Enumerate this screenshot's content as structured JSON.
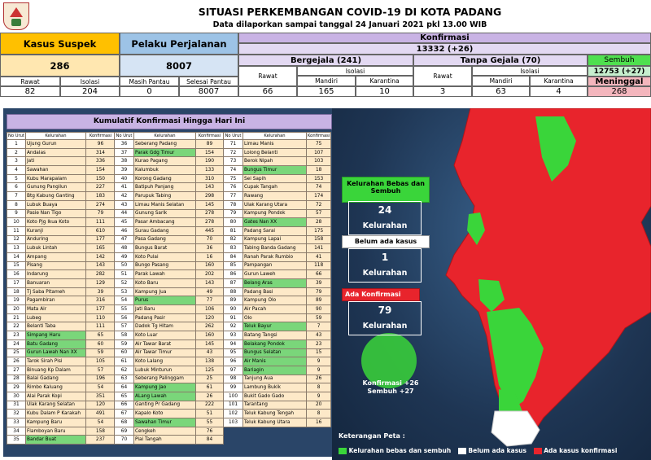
{
  "header": {
    "title": "SITUASI PERKEMBANGAN COVID-19 DI KOTA PADANG",
    "subtitle": "Data dilaporkan sampai tanggal 24 Januari 2021 pkl 13.00 WIB"
  },
  "stats": {
    "suspek_label": "Kasus Suspek",
    "suspek_value": "286",
    "rawat_label": "Rawat",
    "rawat_value": "82",
    "isolasi_label": "Isolasi",
    "isolasi_value": "204",
    "pelaku_label": "Pelaku Perjalanan",
    "pelaku_value": "8007",
    "masih_label": "Masih Pantau",
    "masih_value": "0",
    "selesai_label": "Selesai Pantau",
    "selesai_value": "8007",
    "konfirmasi_label": "Konfirmasi",
    "konfirmasi_value": "13332 (+26)",
    "bergejala_label": "Bergejala (241)",
    "tanpa_label": "Tanpa Gejala (70)",
    "sembuh_label": "Sembuh",
    "sembuh_value": "12753 (+27)",
    "meninggal_label": "Meninggal",
    "meninggal_value": "268",
    "bg_rawat_label": "Rawat",
    "bg_rawat_value": "66",
    "bg_isolasi_label": "Isolasi",
    "bg_mandiri_label": "Mandiri",
    "bg_mandiri_value": "165",
    "bg_karantina_label": "Karantina",
    "bg_karantina_value": "10",
    "tg_rawat_label": "Rawat",
    "tg_rawat_value": "3",
    "tg_isolasi_label": "Isolasi",
    "tg_mandiri_label": "Mandiri",
    "tg_mandiri_value": "63",
    "tg_karantina_label": "Karantina",
    "tg_karantina_value": "4"
  },
  "table": {
    "title": "Kumulatif Konfirmasi Hingga Hari Ini",
    "col_no": "No Urut",
    "col_kel": "Kelurahan",
    "col_konf": "Konfirmasi",
    "rows": [
      [
        "1",
        "Ujung Gurun",
        "96",
        ""
      ],
      [
        "2",
        "Andalas",
        "314",
        ""
      ],
      [
        "3",
        "Jati",
        "336",
        ""
      ],
      [
        "4",
        "Sawahan",
        "154",
        ""
      ],
      [
        "5",
        "Kubu Marapalam",
        "150",
        ""
      ],
      [
        "6",
        "Gunung Pangilun",
        "227",
        ""
      ],
      [
        "7",
        "Btg Kabung Ganting",
        "183",
        ""
      ],
      [
        "8",
        "Lubuk Buaya",
        "274",
        ""
      ],
      [
        "9",
        "Pasie Nan Tigo",
        "79",
        ""
      ],
      [
        "10",
        "Koto Pjg Ikua Koto",
        "111",
        ""
      ],
      [
        "11",
        "Kuranji",
        "610",
        ""
      ],
      [
        "12",
        "Anduring",
        "177",
        ""
      ],
      [
        "13",
        "Lubuk Lintah",
        "165",
        ""
      ],
      [
        "14",
        "Ampang",
        "142",
        ""
      ],
      [
        "15",
        "Pisang",
        "143",
        ""
      ],
      [
        "16",
        "Indarung",
        "282",
        ""
      ],
      [
        "17",
        "Banuaran",
        "129",
        ""
      ],
      [
        "18",
        "Tj Saba Pitameh",
        "39",
        ""
      ],
      [
        "19",
        "Pagambiran",
        "316",
        ""
      ],
      [
        "20",
        "Mata Air",
        "177",
        ""
      ],
      [
        "21",
        "Lubeg",
        "110",
        ""
      ],
      [
        "22",
        "Belanti Taba",
        "111",
        ""
      ],
      [
        "23",
        "Simpang Haru",
        "65",
        "g"
      ],
      [
        "24",
        "Batu Gadang",
        "60",
        "g"
      ],
      [
        "25",
        "Gurun Lawah Nan XX",
        "59",
        "g"
      ],
      [
        "26",
        "Tarok Sirah Pisi",
        "105",
        ""
      ],
      [
        "27",
        "Binuang Kp Dalam",
        "57",
        ""
      ],
      [
        "28",
        "Balai Gadang",
        "196",
        ""
      ],
      [
        "29",
        "Rimbo Kaluang",
        "54",
        ""
      ],
      [
        "30",
        "Alai Parak Kopi",
        "351",
        ""
      ],
      [
        "31",
        "Ulak Karang Selatan",
        "120",
        ""
      ],
      [
        "32",
        "Kubu Dalam P Karakah",
        "491",
        ""
      ],
      [
        "33",
        "Kampung Baru",
        "54",
        ""
      ],
      [
        "34",
        "Flamboyan Baru",
        "158",
        ""
      ],
      [
        "35",
        "Bandar Buat",
        "237",
        "g"
      ]
    ],
    "rows2": [
      [
        "36",
        "Seberang Padang",
        "89",
        ""
      ],
      [
        "37",
        "Parak Gdg Timur",
        "154",
        "g"
      ],
      [
        "38",
        "Kurao Pagang",
        "190",
        ""
      ],
      [
        "39",
        "Kalumbuk",
        "133",
        ""
      ],
      [
        "40",
        "Korong Gadang",
        "310",
        ""
      ],
      [
        "41",
        "Batipuh Panjang",
        "143",
        ""
      ],
      [
        "42",
        "Parupuk Tabing",
        "298",
        ""
      ],
      [
        "43",
        "Limau Manis Selatan",
        "145",
        ""
      ],
      [
        "44",
        "Gunung Sarik",
        "278",
        ""
      ],
      [
        "45",
        "Pasar Ambacang",
        "278",
        ""
      ],
      [
        "46",
        "Surau Gadang",
        "445",
        ""
      ],
      [
        "47",
        "Pasa Gadang",
        "70",
        ""
      ],
      [
        "48",
        "Bungus Barat",
        "36",
        ""
      ],
      [
        "49",
        "Koto Pulai",
        "16",
        ""
      ],
      [
        "50",
        "Bungo Pasang",
        "160",
        ""
      ],
      [
        "51",
        "Parak Lawah",
        "202",
        ""
      ],
      [
        "52",
        "Koto Baru",
        "143",
        ""
      ],
      [
        "53",
        "Kampung Jua",
        "49",
        ""
      ],
      [
        "54",
        "Purus",
        "77",
        "g"
      ],
      [
        "55",
        "Jati Baru",
        "106",
        ""
      ],
      [
        "56",
        "Padang Pasir",
        "120",
        ""
      ],
      [
        "57",
        "Dadok Tg Hitam",
        "262",
        ""
      ],
      [
        "58",
        "Koto Luar",
        "160",
        ""
      ],
      [
        "59",
        "Air Tawar Barat",
        "145",
        ""
      ],
      [
        "60",
        "Air Tawar Timur",
        "43",
        ""
      ],
      [
        "61",
        "Koto Lalang",
        "138",
        ""
      ],
      [
        "62",
        "Lubuk Minturun",
        "125",
        ""
      ],
      [
        "63",
        "Seberang Palinggam",
        "25",
        ""
      ],
      [
        "64",
        "Kampung Jao",
        "61",
        "g"
      ],
      [
        "65",
        "ALang Lawah",
        "26",
        "g"
      ],
      [
        "66",
        "Ganting Pr Gadang",
        "222",
        ""
      ],
      [
        "67",
        "Kapalo Koto",
        "51",
        ""
      ],
      [
        "68",
        "Sawahan Timur",
        "55",
        "g"
      ],
      [
        "69",
        "Cengkeh",
        "76",
        ""
      ],
      [
        "70",
        "Piai Tangah",
        "84",
        ""
      ]
    ],
    "rows3": [
      [
        "71",
        "Limau Manis",
        "75",
        ""
      ],
      [
        "72",
        "Lolong Belanti",
        "107",
        ""
      ],
      [
        "73",
        "Berok Nipah",
        "103",
        ""
      ],
      [
        "74",
        "Bungus Timur",
        "18",
        "g"
      ],
      [
        "75",
        "Sei Sapih",
        "153",
        ""
      ],
      [
        "76",
        "Cupak Tangah",
        "74",
        ""
      ],
      [
        "77",
        "Rawang",
        "174",
        ""
      ],
      [
        "78",
        "Ulak Karang Utara",
        "72",
        ""
      ],
      [
        "79",
        "Kampung Pondok",
        "57",
        ""
      ],
      [
        "80",
        "Gates Nan XX",
        "28",
        "g"
      ],
      [
        "81",
        "Padang Sarai",
        "175",
        ""
      ],
      [
        "82",
        "Kampung Lapai",
        "158",
        ""
      ],
      [
        "83",
        "Tabing Banda Gadang",
        "141",
        ""
      ],
      [
        "84",
        "Ranah Parak Rumbio",
        "41",
        ""
      ],
      [
        "85",
        "Pampangan",
        "118",
        ""
      ],
      [
        "86",
        "Gurun Laweh",
        "66",
        ""
      ],
      [
        "87",
        "Belang Aras",
        "39",
        "g"
      ],
      [
        "88",
        "Padang Basi",
        "79",
        ""
      ],
      [
        "89",
        "Kampung Olo",
        "89",
        ""
      ],
      [
        "90",
        "Air Pacah",
        "90",
        ""
      ],
      [
        "91",
        "Olo",
        "59",
        ""
      ],
      [
        "92",
        "Teluk Bayur",
        "7",
        "g"
      ],
      [
        "93",
        "Batang Tangsi",
        "43",
        ""
      ],
      [
        "94",
        "Belakang Pondok",
        "23",
        "g"
      ],
      [
        "95",
        "Bungus Selatan",
        "15",
        "g"
      ],
      [
        "96",
        "Air Manis",
        "9",
        "g"
      ],
      [
        "97",
        "Bariagin",
        "9",
        "g"
      ],
      [
        "98",
        "Tanjung Aua",
        "26",
        ""
      ],
      [
        "99",
        "Lambung Bukik",
        "8",
        ""
      ],
      [
        "100",
        "Bukit Gado Gado",
        "9",
        ""
      ],
      [
        "101",
        "Tarantang",
        "20",
        ""
      ],
      [
        "102",
        "Teluk Kabung Tengah",
        "8",
        ""
      ],
      [
        "103",
        "Teluk Kabung Utara",
        "16",
        ""
      ]
    ]
  },
  "map": {
    "bebas_title": "Kelurahan Bebas dan Sembuh",
    "bebas_value": "24",
    "bebas_unit": "Kelurahan",
    "belum_title": "Belum ada kasus",
    "belum_value": "1",
    "belum_unit": "Kelurahan",
    "ada_title": "Ada Konfirmasi",
    "ada_value": "79",
    "ada_unit": "Kelurahan",
    "virus_line1": "Konfirmasi +26",
    "virus_line2": "Sembuh +27",
    "legend_title": "Keterangan Peta :",
    "legend_green": "Kelurahan bebas dan sembuh",
    "legend_white": "Belum ada kasus",
    "legend_red": "Ada kasus konfirmasi",
    "color_green": "#3ad53a",
    "color_red": "#e8242c",
    "color_white": "#ffffff"
  }
}
